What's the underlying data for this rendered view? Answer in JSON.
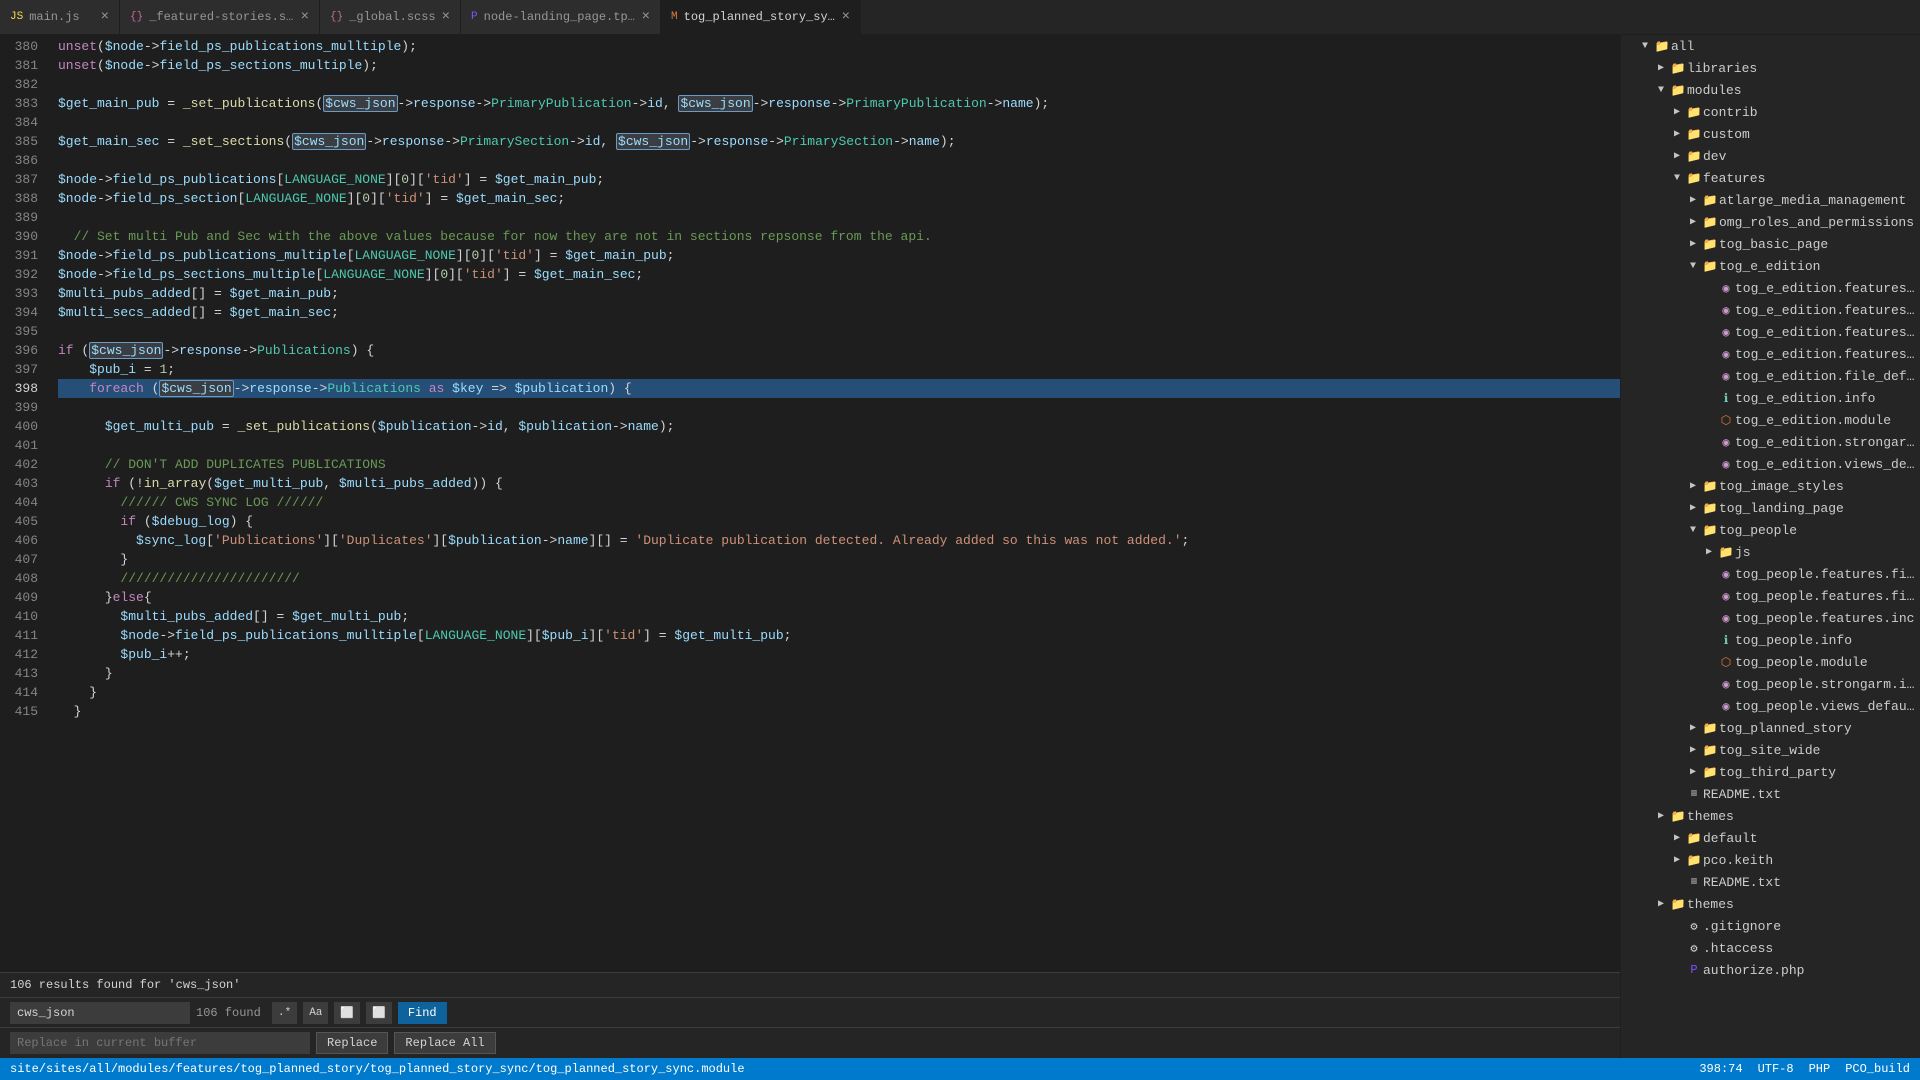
{
  "tabs": [
    {
      "id": "main-js",
      "name": "main.js",
      "icon": "js",
      "active": false,
      "modified": false
    },
    {
      "id": "featured-stories",
      "name": "_featured-stories.scss",
      "icon": "scss",
      "active": false,
      "modified": false
    },
    {
      "id": "global-scss",
      "name": "_global.scss",
      "icon": "scss",
      "active": false,
      "modified": false
    },
    {
      "id": "node-landing",
      "name": "node-landing_page.tpl.php",
      "icon": "php",
      "active": false,
      "modified": false
    },
    {
      "id": "tog-planned",
      "name": "tog_planned_story_sync.module",
      "icon": "module",
      "active": true,
      "modified": false
    }
  ],
  "editor": {
    "lines": [
      {
        "num": 380,
        "code": "  unset($node->field_ps_publications_mulltiple);",
        "type": "normal"
      },
      {
        "num": 381,
        "code": "  unset($node->field_ps_sections_multiple);",
        "type": "normal"
      },
      {
        "num": 382,
        "code": "",
        "type": "normal"
      },
      {
        "num": 383,
        "code": "  $get_main_pub = _set_publications($cws_json->response->PrimaryPublication->id, $cws_json->response->PrimaryPublication->name);",
        "type": "highlight_var"
      },
      {
        "num": 384,
        "code": "",
        "type": "normal"
      },
      {
        "num": 385,
        "code": "  $get_main_sec = _set_sections($cws_json->response->PrimarySection->id, $cws_json->response->PrimarySection->name);",
        "type": "highlight_var"
      },
      {
        "num": 386,
        "code": "",
        "type": "normal"
      },
      {
        "num": 387,
        "code": "  $node->field_ps_publications[LANGUAGE_NONE][0]['tid'] = $get_main_pub;",
        "type": "normal"
      },
      {
        "num": 388,
        "code": "  $node->field_ps_section[LANGUAGE_NONE][0]['tid'] = $get_main_sec;",
        "type": "normal"
      },
      {
        "num": 389,
        "code": "",
        "type": "normal"
      },
      {
        "num": 390,
        "code": "  // Set multi Pub and Sec with the above values because for now they are not in sections repsonse from the api.",
        "type": "comment"
      },
      {
        "num": 391,
        "code": "  $node->field_ps_publications_multiple[LANGUAGE_NONE][0]['tid'] = $get_main_pub;",
        "type": "normal"
      },
      {
        "num": 392,
        "code": "  $node->field_ps_sections_multiple[LANGUAGE_NONE][0]['tid'] = $get_main_sec;",
        "type": "normal"
      },
      {
        "num": 393,
        "code": "  $multi_pubs_added[] = $get_main_pub;",
        "type": "normal"
      },
      {
        "num": 394,
        "code": "  $multi_secs_added[] = $get_main_sec;",
        "type": "normal"
      },
      {
        "num": 395,
        "code": "",
        "type": "normal"
      },
      {
        "num": 396,
        "code": "  if ($cws_json->response->Publications) {",
        "type": "highlight_cws"
      },
      {
        "num": 397,
        "code": "    $pub_i = 1;",
        "type": "normal"
      },
      {
        "num": 398,
        "code": "    foreach ($cws_json->response->Publications as $key => $publication) {",
        "type": "highlight_cws_current"
      },
      {
        "num": 399,
        "code": "",
        "type": "normal"
      },
      {
        "num": 400,
        "code": "      $get_multi_pub = _set_publications($publication->id, $publication->name);",
        "type": "normal"
      },
      {
        "num": 401,
        "code": "",
        "type": "normal"
      },
      {
        "num": 402,
        "code": "      // DON'T ADD DUPLICATES PUBLICATIONS",
        "type": "comment"
      },
      {
        "num": 403,
        "code": "      if (!in_array($get_multi_pub, $multi_pubs_added)) {",
        "type": "normal"
      },
      {
        "num": 404,
        "code": "        ////// CWS SYNC LOG //////",
        "type": "comment"
      },
      {
        "num": 405,
        "code": "        if ($debug_log) {",
        "type": "normal"
      },
      {
        "num": 406,
        "code": "          $sync_log['Publications']['Duplicates'][$publication->name][] = 'Duplicate publication detected. Already added so this was not added.';",
        "type": "normal"
      },
      {
        "num": 407,
        "code": "        }",
        "type": "normal"
      },
      {
        "num": 408,
        "code": "        ///////////////////////",
        "type": "comment"
      },
      {
        "num": 409,
        "code": "      }else{",
        "type": "normal"
      },
      {
        "num": 410,
        "code": "        $multi_pubs_added[] = $get_multi_pub;",
        "type": "normal"
      },
      {
        "num": 411,
        "code": "        $node->field_ps_publications_mulltiple[LANGUAGE_NONE][$pub_i]['tid'] = $get_multi_pub;",
        "type": "normal"
      },
      {
        "num": 412,
        "code": "        $pub_i++;",
        "type": "normal"
      },
      {
        "num": 413,
        "code": "      }",
        "type": "normal"
      },
      {
        "num": 414,
        "code": "    }",
        "type": "normal"
      },
      {
        "num": 415,
        "code": "  }",
        "type": "normal"
      }
    ]
  },
  "search": {
    "results_label": "106 results found for 'cws_json'",
    "find_value": "cws_json",
    "find_count": "106 found",
    "replace_placeholder": "Replace in current buffer",
    "find_placeholder": "Find",
    "replace_label": "Replace",
    "replace_all_label": "Replace All"
  },
  "status_bar": {
    "file_path": "site/sites/all/modules/features/tog_planned_story/tog_planned_story_sync/tog_planned_story_sync.module",
    "position": "398:74",
    "encoding": "UTF-8",
    "language": "PHP",
    "build": "PCO_build"
  },
  "sidebar": {
    "items": [
      {
        "id": "all",
        "label": "all",
        "type": "folder",
        "indent": 0,
        "expanded": true,
        "arrow": "▼"
      },
      {
        "id": "libraries",
        "label": "libraries",
        "type": "folder",
        "indent": 1,
        "expanded": false,
        "arrow": "▶"
      },
      {
        "id": "modules",
        "label": "modules",
        "type": "folder",
        "indent": 1,
        "expanded": true,
        "arrow": "▼"
      },
      {
        "id": "contrib",
        "label": "contrib",
        "type": "folder",
        "indent": 2,
        "expanded": false,
        "arrow": "▶"
      },
      {
        "id": "custom",
        "label": "custom",
        "type": "folder",
        "indent": 2,
        "expanded": false,
        "arrow": "▶"
      },
      {
        "id": "dev",
        "label": "dev",
        "type": "folder",
        "indent": 2,
        "expanded": false,
        "arrow": "▶"
      },
      {
        "id": "features",
        "label": "features",
        "type": "folder",
        "indent": 2,
        "expanded": true,
        "arrow": "▼"
      },
      {
        "id": "atlarge_media_management",
        "label": "atlarge_media_management",
        "type": "folder",
        "indent": 3,
        "expanded": false,
        "arrow": "▶"
      },
      {
        "id": "omg_roles_and_permissions",
        "label": "omg_roles_and_permissions",
        "type": "folder",
        "indent": 3,
        "expanded": false,
        "arrow": "▶"
      },
      {
        "id": "tog_basic_page",
        "label": "tog_basic_page",
        "type": "folder",
        "indent": 3,
        "expanded": false,
        "arrow": "▶"
      },
      {
        "id": "tog_e_edition",
        "label": "tog_e_edition",
        "type": "folder",
        "indent": 3,
        "expanded": true,
        "arrow": "▼"
      },
      {
        "id": "tog_e_edition_field_base",
        "label": "tog_e_edition.features.field_base.inc",
        "type": "file_inc",
        "indent": 4
      },
      {
        "id": "tog_e_edition_field_instance",
        "label": "tog_e_edition.features.field_instance.inc",
        "type": "file_inc",
        "indent": 4
      },
      {
        "id": "tog_e_edition_features_inc",
        "label": "tog_e_edition.features.inc",
        "type": "file_inc",
        "indent": 4
      },
      {
        "id": "tog_e_edition_taxonomy_inc",
        "label": "tog_e_edition.features.taxonomy.inc",
        "type": "file_inc",
        "indent": 4
      },
      {
        "id": "tog_e_edition_file_default",
        "label": "tog_e_edition.file_default_displays.inc",
        "type": "file_inc",
        "indent": 4
      },
      {
        "id": "tog_e_edition_info",
        "label": "tog_e_edition.info",
        "type": "file_info",
        "indent": 4
      },
      {
        "id": "tog_e_edition_module",
        "label": "tog_e_edition.module",
        "type": "file_module",
        "indent": 4
      },
      {
        "id": "tog_e_edition_strongarm",
        "label": "tog_e_edition.strongarm.inc",
        "type": "file_inc",
        "indent": 4
      },
      {
        "id": "tog_e_edition_views_default",
        "label": "tog_e_edition.views_default.inc",
        "type": "file_inc",
        "indent": 4
      },
      {
        "id": "tog_image_styles",
        "label": "tog_image_styles",
        "type": "folder",
        "indent": 3,
        "expanded": false,
        "arrow": "▶"
      },
      {
        "id": "tog_landing_page",
        "label": "tog_landing_page",
        "type": "folder",
        "indent": 3,
        "expanded": false,
        "arrow": "▶"
      },
      {
        "id": "tog_people",
        "label": "tog_people",
        "type": "folder",
        "indent": 3,
        "expanded": true,
        "arrow": "▼"
      },
      {
        "id": "tog_people_js",
        "label": "js",
        "type": "folder",
        "indent": 4,
        "expanded": false,
        "arrow": "▶"
      },
      {
        "id": "tog_people_field_base",
        "label": "tog_people.features.field_base.inc",
        "type": "file_inc",
        "indent": 4
      },
      {
        "id": "tog_people_field_instance",
        "label": "tog_people.features.field_instance.inc",
        "type": "file_inc",
        "indent": 4
      },
      {
        "id": "tog_people_features_inc",
        "label": "tog_people.features.inc",
        "type": "file_inc",
        "indent": 4
      },
      {
        "id": "tog_people_info",
        "label": "tog_people.info",
        "type": "file_info",
        "indent": 4
      },
      {
        "id": "tog_people_module",
        "label": "tog_people.module",
        "type": "file_module",
        "indent": 4
      },
      {
        "id": "tog_people_strongarm",
        "label": "tog_people.strongarm.inc",
        "type": "file_inc",
        "indent": 4
      },
      {
        "id": "tog_people_views_default",
        "label": "tog_people.views_default.inc",
        "type": "file_inc",
        "indent": 4
      },
      {
        "id": "tog_planned_story",
        "label": "tog_planned_story",
        "type": "folder",
        "indent": 3,
        "expanded": false,
        "arrow": "▶"
      },
      {
        "id": "tog_site_wide",
        "label": "tog_site_wide",
        "type": "folder",
        "indent": 3,
        "expanded": false,
        "arrow": "▶"
      },
      {
        "id": "tog_third_party",
        "label": "tog_third_party",
        "type": "folder",
        "indent": 3,
        "expanded": false,
        "arrow": "▶"
      },
      {
        "id": "readme_txt",
        "label": "README.txt",
        "type": "file_txt",
        "indent": 2
      },
      {
        "id": "themes_folder_1",
        "label": "themes",
        "type": "folder",
        "indent": 1,
        "expanded": false,
        "arrow": "▶"
      },
      {
        "id": "default_folder",
        "label": "default",
        "type": "folder",
        "indent": 2,
        "expanded": false,
        "arrow": "▶"
      },
      {
        "id": "pco_keith_folder",
        "label": "pco.keith",
        "type": "folder",
        "indent": 2,
        "expanded": false,
        "arrow": "▶"
      },
      {
        "id": "readme_txt_2",
        "label": "README.txt",
        "type": "file_txt",
        "indent": 2
      },
      {
        "id": "themes_folder_2",
        "label": "themes",
        "type": "folder",
        "indent": 1,
        "expanded": false,
        "arrow": "▶"
      },
      {
        "id": "gitignore",
        "label": ".gitignore",
        "type": "file_git",
        "indent": 2
      },
      {
        "id": "htaccess",
        "label": ".htaccess",
        "type": "file_git",
        "indent": 2
      },
      {
        "id": "authorize_php",
        "label": "authorize.php",
        "type": "file_php",
        "indent": 2
      }
    ]
  },
  "icons": {
    "folder": "📁",
    "js": "JS",
    "scss": "{}",
    "php": "PHP",
    "module": "M",
    "inc": "I",
    "info": "i",
    "txt": "T",
    "git": "G"
  }
}
